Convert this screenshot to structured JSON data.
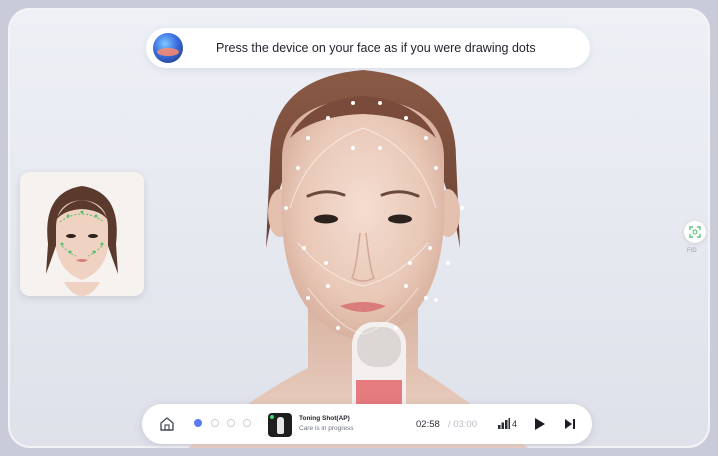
{
  "instruction": {
    "text": "Press the device on your face as if you were drawing dots"
  },
  "reference": {
    "alt": "Reference face guide"
  },
  "side": {
    "faceid_label": "FID"
  },
  "player": {
    "steps": [
      "1",
      "2",
      "3",
      "4"
    ],
    "active_step": 1,
    "mode_title": "Toning Shot(AP)",
    "mode_status": "Care is in progress",
    "time_elapsed": "02:58",
    "time_total": "/ 03:00",
    "intensity_level": "4"
  },
  "colors": {
    "accent": "#5d78f5",
    "status_green": "#38d96b"
  }
}
